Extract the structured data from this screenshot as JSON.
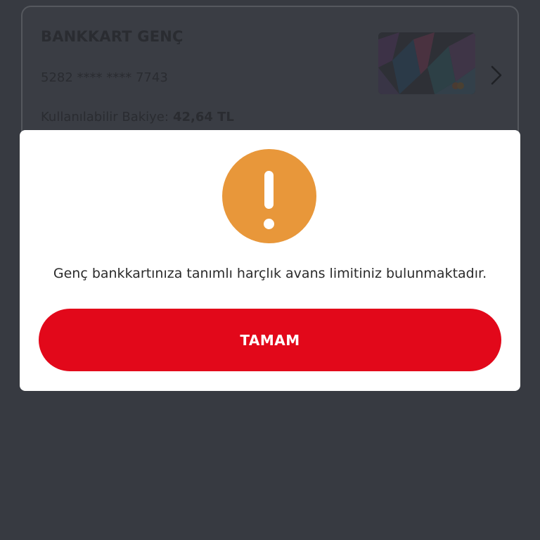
{
  "card": {
    "title": "BANKKART GENÇ",
    "number": "5282 **** **** 7743",
    "balance_label": "Kullanılabilir Bakiye:",
    "balance_value": "42,64 TL"
  },
  "modal": {
    "icon": "exclamation-icon",
    "message": "Genç bankkartınıza tanımlı harçlık avans limitiniz bulunmaktadır.",
    "ok_label": "TAMAM"
  },
  "colors": {
    "background": "#373a41",
    "modal_bg": "#ffffff",
    "alert_icon": "#e8973a",
    "primary_button": "#e2081a"
  }
}
